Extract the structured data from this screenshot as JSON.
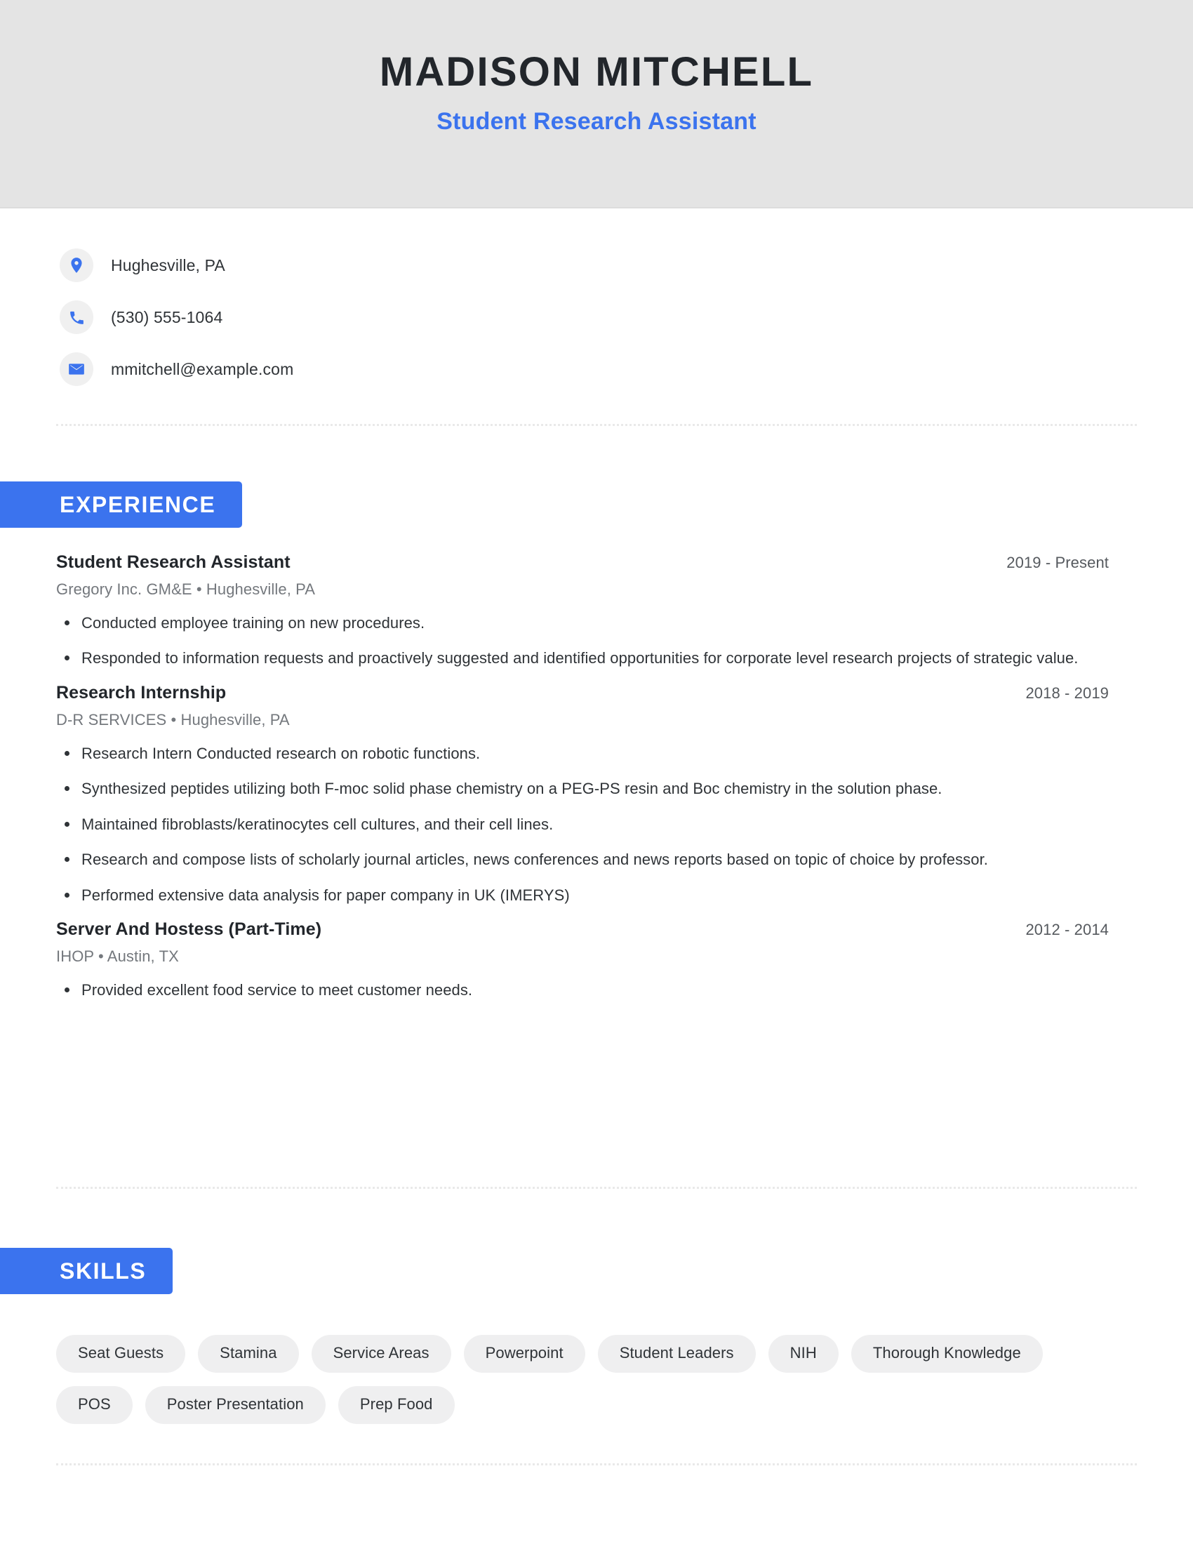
{
  "header": {
    "name": "MADISON MITCHELL",
    "title": "Student Research Assistant",
    "background_color": "#e4e4e4",
    "accent_color": "#3b73ee"
  },
  "contact": {
    "items": [
      {
        "icon": "location-pin-icon",
        "value": "Hughesville, PA"
      },
      {
        "icon": "phone-icon",
        "value": "(530) 555-1064"
      },
      {
        "icon": "email-icon",
        "value": "mmitchell@example.com"
      }
    ]
  },
  "sections": {
    "experience": {
      "heading": "EXPERIENCE",
      "jobs": [
        {
          "role": "Student Research Assistant",
          "dates": "2019 - Present",
          "company": "Gregory Inc. GM&E",
          "location": "Hughesville, PA",
          "meta": "Gregory Inc. GM&E • Hughesville, PA",
          "bullets": [
            "Conducted employee training on new procedures.",
            "Responded to information requests and proactively suggested and identified opportunities for corporate level research projects of strategic value."
          ]
        },
        {
          "role": "Research Internship",
          "dates": "2018 - 2019",
          "company": "D-R SERVICES",
          "location": "Hughesville, PA",
          "meta": "D-R SERVICES • Hughesville, PA",
          "bullets": [
            "Research Intern Conducted research on robotic functions.",
            "Synthesized peptides utilizing both F-moc solid phase chemistry on a PEG-PS resin and Boc chemistry in the solution phase.",
            "Maintained fibroblasts/keratinocytes cell cultures, and their cell lines.",
            "Research and compose lists of scholarly journal articles, news conferences and news reports based on topic of choice by professor.",
            "Performed extensive data analysis for paper company in UK (IMERYS)"
          ]
        },
        {
          "role": "Server And Hostess (Part-Time)",
          "dates": "2012 - 2014",
          "company": "IHOP",
          "location": "Austin, TX",
          "meta": "IHOP • Austin, TX",
          "bullets": [
            "Provided excellent food service to meet customer needs."
          ]
        }
      ]
    },
    "skills": {
      "heading": "SKILLS",
      "chips": [
        "Seat Guests",
        "Stamina",
        "Service Areas",
        "Powerpoint",
        "Student Leaders",
        "NIH",
        "Thorough Knowledge",
        "POS",
        "Poster Presentation",
        "Prep Food"
      ]
    }
  }
}
